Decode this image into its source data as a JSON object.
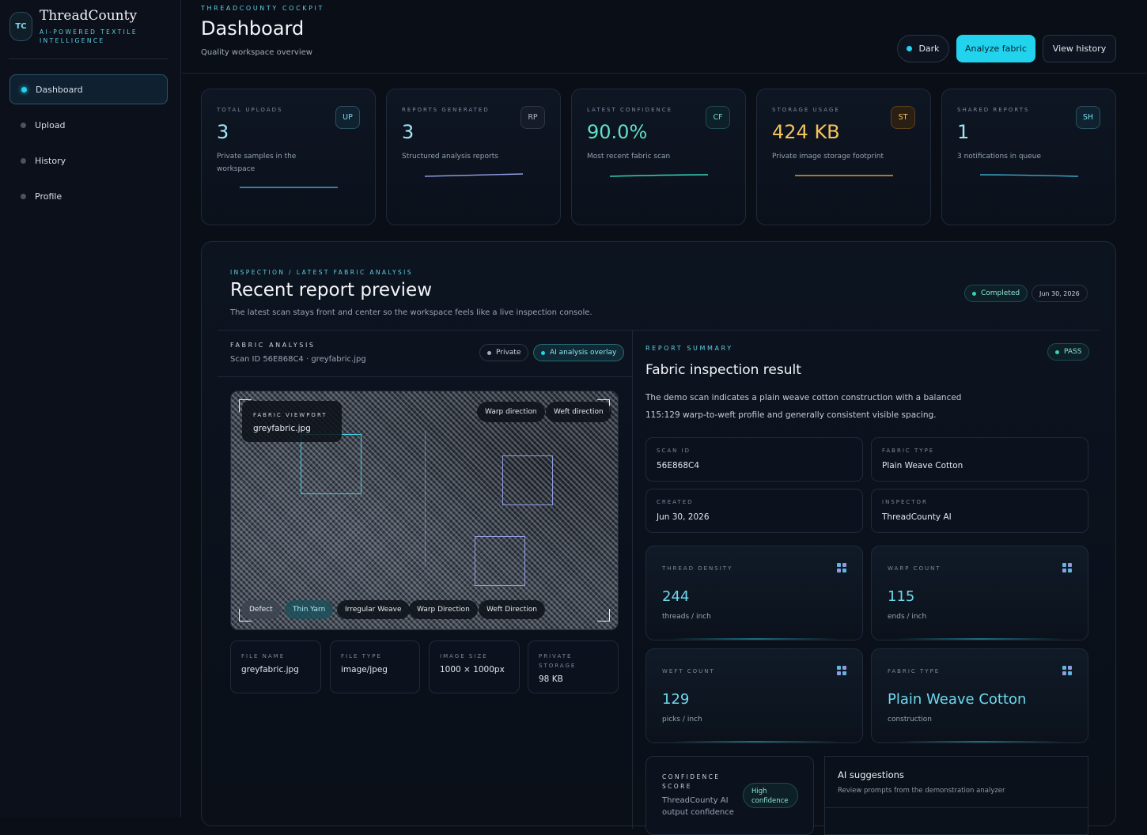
{
  "sidebar": {
    "logo_initials": "TC",
    "brand": "ThreadCounty",
    "tagline": "AI-POWERED TEXTILE INTELLIGENCE",
    "items": [
      {
        "label": "Dashboard",
        "active": true
      },
      {
        "label": "Upload",
        "active": false
      },
      {
        "label": "History",
        "active": false
      },
      {
        "label": "Profile",
        "active": false
      }
    ]
  },
  "header": {
    "eyebrow": "THREADCOUNTY COCKPIT",
    "title": "Dashboard",
    "subtitle": "Quality workspace overview",
    "theme_label": "Dark",
    "analyze_label": "Analyze fabric",
    "history_label": "View history"
  },
  "stats": [
    {
      "label": "TOTAL UPLOADS",
      "icon": "UP",
      "value": "3",
      "desc": "Private samples in the workspace",
      "color": "#9fe7f5",
      "spark": "#3aa7c8"
    },
    {
      "label": "REPORTS GENERATED",
      "icon": "RP",
      "value": "3",
      "desc": "Structured analysis reports",
      "color": "#9fe7f5",
      "spark": "#8f9ce0"
    },
    {
      "label": "LATEST CONFIDENCE",
      "icon": "CF",
      "value": "90.0%",
      "desc": "Most recent fabric scan",
      "color": "#5fe0c8",
      "spark": "#34d3b6"
    },
    {
      "label": "STORAGE USAGE",
      "icon": "ST",
      "value": "424 KB",
      "desc": "Private image storage footprint",
      "color": "#f4c25a",
      "spark": "#d99a3e"
    },
    {
      "label": "SHARED REPORTS",
      "icon": "SH",
      "value": "1",
      "desc": "3 notifications in queue",
      "color": "#9fe7f5",
      "spark": "#3aa7c8"
    }
  ],
  "report": {
    "eyebrow": "INSPECTION / LATEST FABRIC ANALYSIS",
    "title": "Recent report preview",
    "subtitle": "The latest scan stays front and center so the workspace feels like a live inspection console.",
    "status": "Completed",
    "date": "Jun 30, 2026"
  },
  "analysis": {
    "eyebrow": "FABRIC ANALYSIS",
    "scan_line": "Scan ID 56E868C4 · greyfabric.jpg",
    "privacy_pill": "Private",
    "overlay_pill": "AI analysis overlay",
    "viewport_eyebrow": "FABRIC VIEWPORT",
    "viewport_file": "greyfabric.jpg",
    "warp_btn": "Warp direction",
    "weft_btn": "Weft direction",
    "tags": [
      "Defect",
      "Thin Yarn",
      "Irregular Weave",
      "Warp Direction",
      "Weft Direction"
    ],
    "meta": [
      {
        "k": "FILE NAME",
        "v": "greyfabric.jpg"
      },
      {
        "k": "FILE TYPE",
        "v": "image/jpeg"
      },
      {
        "k": "IMAGE SIZE",
        "v": "1000 × 1000px"
      },
      {
        "k": "PRIVATE STORAGE",
        "v": "98 KB"
      }
    ]
  },
  "summary": {
    "eyebrow": "REPORT SUMMARY",
    "pass": "PASS",
    "title": "Fabric inspection result",
    "desc": "The demo scan indicates a plain weave cotton construction with a balanced 115:129 warp-to-weft profile and generally consistent visible spacing.",
    "info": [
      {
        "k": "SCAN ID",
        "v": "56E868C4"
      },
      {
        "k": "FABRIC TYPE",
        "v": "Plain Weave Cotton"
      },
      {
        "k": "CREATED",
        "v": "Jun 30, 2026"
      },
      {
        "k": "INSPECTOR",
        "v": "ThreadCounty AI"
      }
    ],
    "metrics": [
      {
        "k": "THREAD DENSITY",
        "v": "244",
        "u": "threads / inch"
      },
      {
        "k": "WARP COUNT",
        "v": "115",
        "u": "ends / inch"
      },
      {
        "k": "WEFT COUNT",
        "v": "129",
        "u": "picks / inch"
      },
      {
        "k": "FABRIC TYPE",
        "v": "Plain Weave Cotton",
        "u": "construction"
      }
    ],
    "confidence_eyebrow": "CONFIDENCE SCORE",
    "confidence_sub": "ThreadCounty AI output confidence",
    "confidence_badge": "High confidence",
    "suggestions_title": "AI suggestions",
    "suggestions_sub": "Review prompts from the demonstration analyzer"
  }
}
